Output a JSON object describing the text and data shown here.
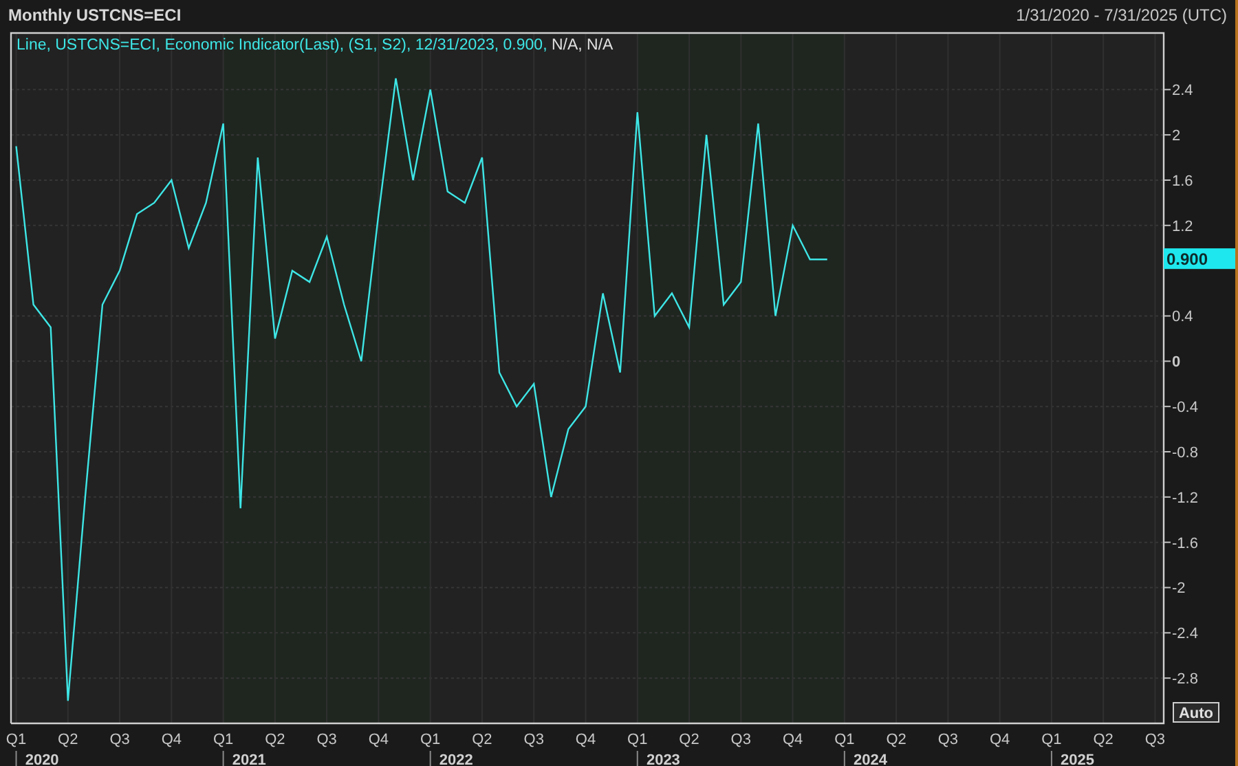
{
  "title": "Monthly USTCNS=ECI",
  "date_range": "1/31/2020 - 7/31/2025 (UTC)",
  "legend": {
    "text": "Line, USTCNS=ECI, Economic Indicator(Last), (S1, S2),  12/31/2023, 0.900,",
    "extra": "N/A, N/A"
  },
  "last_value_label": "0.900",
  "auto_button": "Auto",
  "year_labels": [
    "2020",
    "2021",
    "2022",
    "2023",
    "2024",
    "2025"
  ],
  "chart_data": {
    "type": "line",
    "grid": true,
    "ylim": [
      -3.2,
      2.9
    ],
    "categories": [
      "Q1",
      null,
      null,
      "Q2",
      null,
      null,
      "Q3",
      null,
      null,
      "Q4",
      null,
      null,
      "Q1",
      null,
      null,
      "Q2",
      null,
      null,
      "Q3",
      null,
      null,
      "Q4",
      null,
      null,
      "Q1",
      null,
      null,
      "Q2",
      null,
      null,
      "Q3",
      null,
      null,
      "Q4",
      null,
      null,
      "Q1",
      null,
      null,
      "Q2",
      null,
      null,
      "Q3",
      null,
      null,
      "Q4",
      null,
      null,
      "Q1",
      null,
      null,
      "Q2",
      null,
      null,
      "Q3",
      null,
      null,
      "Q4",
      null,
      null,
      "Q1",
      null,
      null,
      "Q2",
      null,
      null,
      "Q3"
    ],
    "series": [
      {
        "color": "#3ee6e6",
        "values": [
          1.9,
          0.5,
          0.3,
          -3.0,
          -1.2,
          0.5,
          0.8,
          1.3,
          1.4,
          1.6,
          1.0,
          1.4,
          2.1,
          -1.3,
          1.8,
          0.2,
          0.8,
          0.7,
          1.1,
          0.5,
          0.0,
          1.3,
          2.5,
          1.6,
          2.4,
          1.5,
          1.4,
          1.8,
          -0.1,
          -0.4,
          -0.2,
          -1.2,
          -0.6,
          -0.4,
          0.6,
          -0.1,
          2.2,
          0.4,
          0.6,
          0.3,
          2.0,
          0.5,
          0.7,
          2.1,
          0.4,
          1.2,
          0.9,
          0.9,
          null,
          null,
          null,
          null,
          null,
          null,
          null,
          null,
          null,
          null,
          null,
          null,
          null,
          null,
          null,
          null,
          null,
          null,
          null
        ]
      }
    ],
    "yticks": [
      2.4,
      2,
      1.6,
      1.2,
      0.4,
      0,
      -0.4,
      -0.8,
      -1.2,
      -1.6,
      -2,
      -2.4,
      -2.8
    ]
  }
}
